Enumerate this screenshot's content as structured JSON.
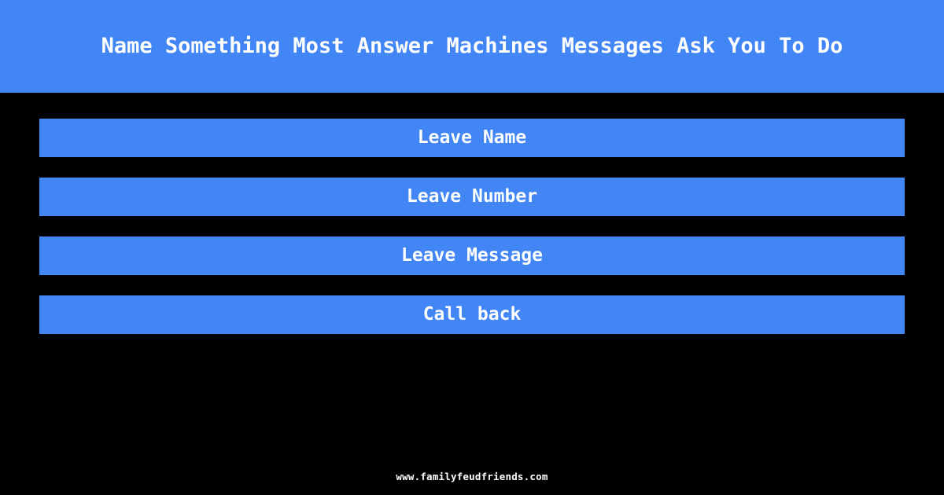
{
  "theme": {
    "background_color": "#000000",
    "accent_color": "#4285f4",
    "text_color": "#ffffff"
  },
  "header": {
    "title": "Name Something Most Answer Machines Messages Ask You To Do"
  },
  "answers": [
    {
      "label": "Leave Name"
    },
    {
      "label": "Leave Number"
    },
    {
      "label": "Leave Message"
    },
    {
      "label": "Call back"
    }
  ],
  "footer": {
    "site": "www.familyfeudfriends.com"
  }
}
